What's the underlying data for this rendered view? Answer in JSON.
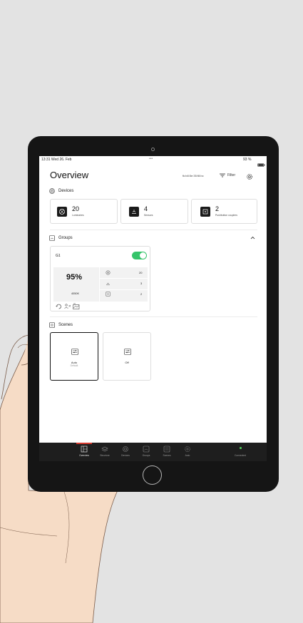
{
  "status_bar": {
    "time_date": "13:31  Wed 26. Feb",
    "battery": "93 %",
    "dots": "•••"
  },
  "header": {
    "title": "Overview",
    "device_id": "fk:b8:5e:35:f8:bc",
    "filter_label": "Filter"
  },
  "devices": {
    "title": "Devices",
    "cards": [
      {
        "count": "20",
        "label": "Luminaires",
        "icon": "luminaire-icon"
      },
      {
        "count": "4",
        "label": "Sensors",
        "icon": "sensor-icon"
      },
      {
        "count": "2",
        "label": "Pushbutton couplers",
        "icon": "pushbutton-icon"
      }
    ]
  },
  "groups": {
    "title": "Groups",
    "items": [
      {
        "name": "G1",
        "enabled": true,
        "level": "95%",
        "cct": "4050K",
        "luminaires": "20",
        "sensors": "3",
        "pushbuttons": "2"
      }
    ]
  },
  "scenes": {
    "title": "Scenes",
    "items": [
      {
        "name": "Auto",
        "sub": "Default",
        "selected": true
      },
      {
        "name": "Off",
        "sub": "",
        "selected": false
      }
    ]
  },
  "nav": {
    "items": [
      {
        "label": "Overview",
        "active": true,
        "icon": "overview-icon"
      },
      {
        "label": "Structure",
        "active": false,
        "icon": "structure-icon"
      },
      {
        "label": "Devices",
        "active": false,
        "icon": "devices-icon"
      },
      {
        "label": "Groups",
        "active": false,
        "icon": "groups-icon"
      },
      {
        "label": "Scenes",
        "active": false,
        "icon": "scenes-icon"
      },
      {
        "label": "Auto",
        "active": false,
        "icon": "auto-icon"
      }
    ],
    "connection": "Connected"
  },
  "colors": {
    "accent_red": "#d63a2f",
    "toggle_green": "#35c46a",
    "connected_green": "#4fd05a",
    "nav_bg": "#1e1e1e"
  }
}
